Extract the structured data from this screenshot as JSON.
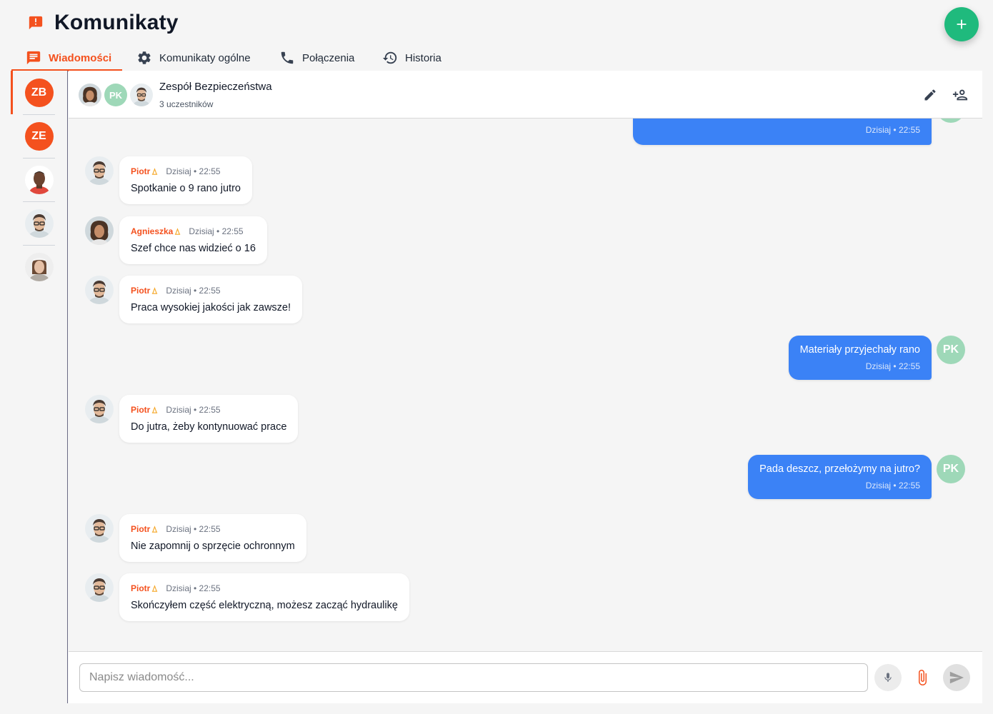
{
  "page": {
    "title": "Komunikaty"
  },
  "tabs": [
    {
      "label": "Wiadomości",
      "icon": "chat-icon",
      "active": true
    },
    {
      "label": "Komunikaty ogólne",
      "icon": "gear-icon",
      "active": false
    },
    {
      "label": "Połączenia",
      "icon": "phone-icon",
      "active": false
    },
    {
      "label": "Historia",
      "icon": "history-icon",
      "active": false
    }
  ],
  "sidebar": {
    "items": [
      {
        "type": "initials",
        "initials": "ZB",
        "active": true
      },
      {
        "type": "initials",
        "initials": "ZE",
        "active": false
      },
      {
        "type": "photo",
        "icon": "person-avatar-icon"
      },
      {
        "type": "photo",
        "icon": "person-avatar-icon"
      },
      {
        "type": "photo",
        "icon": "person-avatar-icon"
      }
    ]
  },
  "chat": {
    "group_name": "Zespół Bezpieczeństwa",
    "participants": "3 uczestników",
    "header_avatar_initials": "PK",
    "messages": [
      {
        "direction": "out",
        "time": "Dzisiaj • 22:55",
        "text": "",
        "avatar": "PK"
      },
      {
        "direction": "in",
        "sender": "Piotr",
        "time": "Dzisiaj • 22:55",
        "text": "Spotkanie o 9 rano jutro"
      },
      {
        "direction": "in",
        "sender": "Agnieszka",
        "time": "Dzisiaj • 22:55",
        "text": "Szef chce nas widzieć o 16"
      },
      {
        "direction": "in",
        "sender": "Piotr",
        "time": "Dzisiaj • 22:55",
        "text": "Praca wysokiej jakości jak zawsze!"
      },
      {
        "direction": "out",
        "time": "Dzisiaj • 22:55",
        "text": "Materiały przyjechały rano",
        "avatar": "PK"
      },
      {
        "direction": "in",
        "sender": "Piotr",
        "time": "Dzisiaj • 22:55",
        "text": "Do jutra, żeby kontynuować prace"
      },
      {
        "direction": "out",
        "time": "Dzisiaj • 22:55",
        "text": "Pada deszcz, przełożymy na jutro?",
        "avatar": "PK"
      },
      {
        "direction": "in",
        "sender": "Piotr",
        "time": "Dzisiaj • 22:55",
        "text": "Nie zapomnij o sprzęcie ochronnym"
      },
      {
        "direction": "in",
        "sender": "Piotr",
        "time": "Dzisiaj • 22:55",
        "text": "Skończyłem część elektryczną, możesz zacząć hydraulikę"
      }
    ]
  },
  "composer": {
    "placeholder": "Napisz wiadomość..."
  },
  "colors": {
    "accent": "#f4511e",
    "fab": "#1fba7d",
    "outgoing": "#3b82f6",
    "pk_avatar": "#9ed8b8"
  }
}
